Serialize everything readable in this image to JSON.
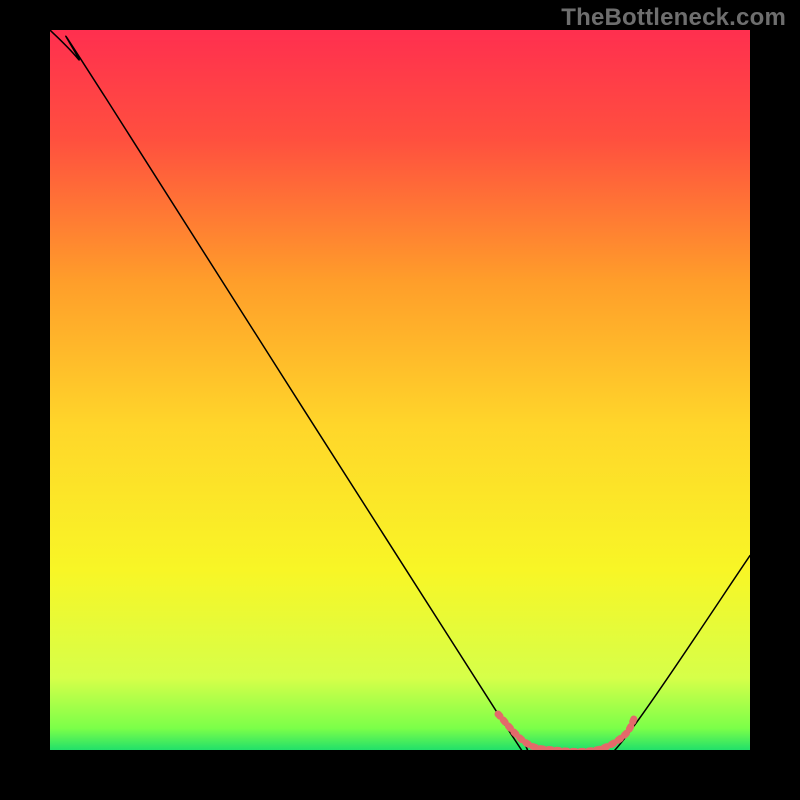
{
  "watermark": {
    "text": "TheBottleneck.com"
  },
  "chart_data": {
    "type": "line",
    "title": "",
    "xlabel": "",
    "ylabel": "",
    "xlim": [
      0,
      100
    ],
    "ylim": [
      0,
      100
    ],
    "grid": false,
    "background_gradient": {
      "stops": [
        {
          "offset": 0,
          "color": "#ff2f4f"
        },
        {
          "offset": 0.15,
          "color": "#ff4f3f"
        },
        {
          "offset": 0.35,
          "color": "#ff9e2a"
        },
        {
          "offset": 0.55,
          "color": "#ffd62a"
        },
        {
          "offset": 0.75,
          "color": "#f8f626"
        },
        {
          "offset": 0.9,
          "color": "#d6ff49"
        },
        {
          "offset": 0.97,
          "color": "#7bff49"
        },
        {
          "offset": 1.0,
          "color": "#22e06a"
        }
      ]
    },
    "series": [
      {
        "name": "bottleneck-curve",
        "color": "#000000",
        "stroke_width": 1.5,
        "points": [
          {
            "x": 0,
            "y": 100
          },
          {
            "x": 4,
            "y": 96
          },
          {
            "x": 8,
            "y": 90.5
          },
          {
            "x": 65,
            "y": 3.5
          },
          {
            "x": 68,
            "y": 1
          },
          {
            "x": 72,
            "y": 0
          },
          {
            "x": 78,
            "y": 0
          },
          {
            "x": 82,
            "y": 1.5
          },
          {
            "x": 100,
            "y": 27
          }
        ]
      },
      {
        "name": "optimal-zone-marker",
        "color": "#e36a6a",
        "stroke_width": 7,
        "dash": [
          3,
          5
        ],
        "points": [
          {
            "x": 64,
            "y": 5
          },
          {
            "x": 68,
            "y": 1
          },
          {
            "x": 72,
            "y": 0
          },
          {
            "x": 78,
            "y": 0
          },
          {
            "x": 82,
            "y": 2
          },
          {
            "x": 83.5,
            "y": 4.5
          }
        ]
      }
    ]
  }
}
